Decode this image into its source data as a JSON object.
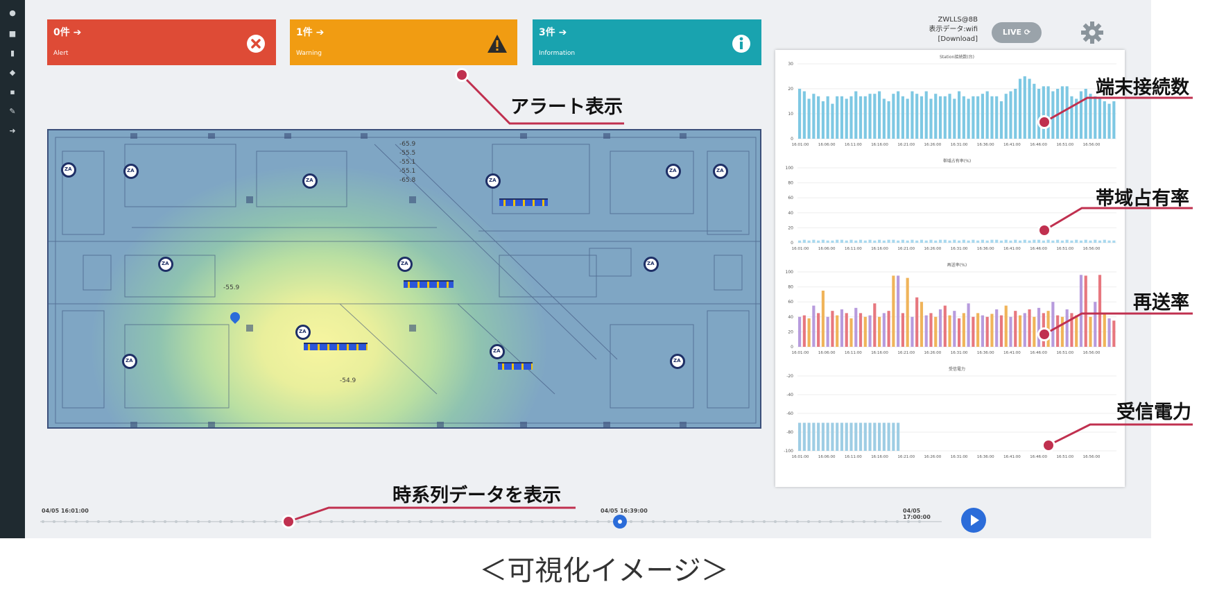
{
  "alerts": {
    "alert": {
      "count": "0件 ➔",
      "label": "Alert",
      "color": "#de4b36"
    },
    "warning": {
      "count": "1件 ➔",
      "label": "Warning",
      "color": "#f19c12"
    },
    "information": {
      "count": "3件 ➔",
      "label": "Information",
      "color": "#19a3af"
    }
  },
  "header": {
    "line1": "ZWLLS@8B",
    "line2": "表示データ:wifi",
    "line3": "[Download]",
    "live_label": "LIVE"
  },
  "callouts": {
    "alert_display": "アラート表示",
    "terminals": "端末接続数",
    "bandwidth": "帯域占有率",
    "retransmit": "再送率",
    "rssi": "受信電力",
    "timeseries": "時系列データを表示"
  },
  "map_labels": {
    "list": [
      "-65.9",
      "-55.5",
      "-55.1",
      "-55.1",
      "-65.8"
    ],
    "left": "-55.9",
    "bottom": "-54.9"
  },
  "timeline": {
    "start": "04/05 16:01:00",
    "current": "04/05 16:39:00",
    "end": "04/05 17:00:00"
  },
  "caption": "＜可視化イメージ＞",
  "chart_data": [
    {
      "type": "bar",
      "title": "Station接続数(台)",
      "ylim": [
        0,
        30
      ],
      "yticks": [
        "0",
        "10",
        "20",
        "30"
      ],
      "categories": [
        "16:01:00",
        "16:06:00",
        "16:11:00",
        "16:16:00",
        "16:21:00",
        "16:26:00",
        "16:31:00",
        "16:36:00",
        "16:41:00",
        "16:46:00",
        "16:51:00",
        "16:56:00"
      ],
      "values": [
        20,
        19,
        16,
        18,
        17,
        15,
        17,
        14,
        17,
        17,
        16,
        17,
        19,
        17,
        17,
        18,
        18,
        19,
        16,
        15,
        18,
        19,
        17,
        16,
        19,
        18,
        17,
        19,
        16,
        18,
        17,
        17,
        18,
        16,
        19,
        17,
        16,
        17,
        17,
        18,
        19,
        17,
        17,
        15,
        18,
        19,
        20,
        24,
        25,
        24,
        22,
        20,
        21,
        21,
        19,
        20,
        21,
        21,
        17,
        16,
        19,
        20,
        18,
        17,
        16,
        15,
        14,
        15
      ]
    },
    {
      "type": "bar",
      "title": "帯域占有率(%)",
      "ylim": [
        0,
        100
      ],
      "yticks": [
        "0",
        "20",
        "40",
        "60",
        "80",
        "100"
      ],
      "categories": [
        "16:01:00",
        "16:06:00",
        "16:11:00",
        "16:16:00",
        "16:21:00",
        "16:26:00",
        "16:31:00",
        "16:36:00",
        "16:41:00",
        "16:46:00",
        "16:51:00",
        "16:56:00"
      ],
      "values": [
        3,
        4,
        3,
        4,
        3,
        4,
        3,
        3,
        4,
        4,
        3,
        4,
        3,
        4,
        3,
        4,
        3,
        4,
        3,
        4,
        4,
        3,
        4,
        3,
        4,
        3,
        4,
        3,
        4,
        3,
        4,
        4,
        3,
        4,
        3,
        4,
        3,
        4,
        3,
        4,
        3,
        4,
        4,
        3,
        4,
        3,
        4,
        3,
        4,
        3,
        4,
        4,
        3,
        4,
        3,
        4,
        3,
        4,
        3,
        4,
        3,
        4,
        3,
        4,
        3,
        4,
        3,
        3
      ]
    },
    {
      "type": "bar",
      "title": "再送率(%)",
      "ylim": [
        0,
        100
      ],
      "yticks": [
        "0",
        "20",
        "40",
        "60",
        "80",
        "100"
      ],
      "categories": [
        "16:01:00",
        "16:06:00",
        "16:11:00",
        "16:16:00",
        "16:21:00",
        "16:26:00",
        "16:31:00",
        "16:36:00",
        "16:41:00",
        "16:46:00",
        "16:51:00",
        "16:56:00"
      ],
      "values": [
        40,
        42,
        38,
        55,
        45,
        75,
        40,
        48,
        42,
        50,
        45,
        38,
        52,
        45,
        40,
        42,
        58,
        40,
        45,
        48,
        95,
        95,
        45,
        92,
        40,
        66,
        60,
        42,
        45,
        40,
        50,
        55,
        42,
        48,
        38,
        45,
        58,
        40,
        45,
        42,
        40,
        44,
        50,
        42,
        55,
        40,
        48,
        42,
        45,
        50,
        40,
        52,
        45,
        48,
        60,
        42,
        40,
        50,
        45,
        42,
        96,
        95,
        40,
        60,
        96,
        45,
        38,
        35
      ]
    },
    {
      "type": "bar",
      "title": "受信電力",
      "ylim": [
        -100,
        -20
      ],
      "yticks": [
        "-100",
        "-80",
        "-60",
        "-40",
        "-20"
      ],
      "categories": [
        "16:01:00",
        "16:06:00",
        "16:11:00",
        "16:16:00",
        "16:21:00",
        "16:26:00",
        "16:31:00",
        "16:36:00",
        "16:41:00",
        "16:46:00",
        "16:51:00",
        "16:56:00"
      ],
      "values": [
        -70,
        -70,
        -70,
        -70,
        -70,
        -70,
        -70,
        -70,
        -70,
        -70,
        -70,
        -70,
        -70,
        -70,
        -70,
        -70,
        -70,
        -70,
        -70,
        -70,
        -70,
        -70
      ]
    }
  ]
}
